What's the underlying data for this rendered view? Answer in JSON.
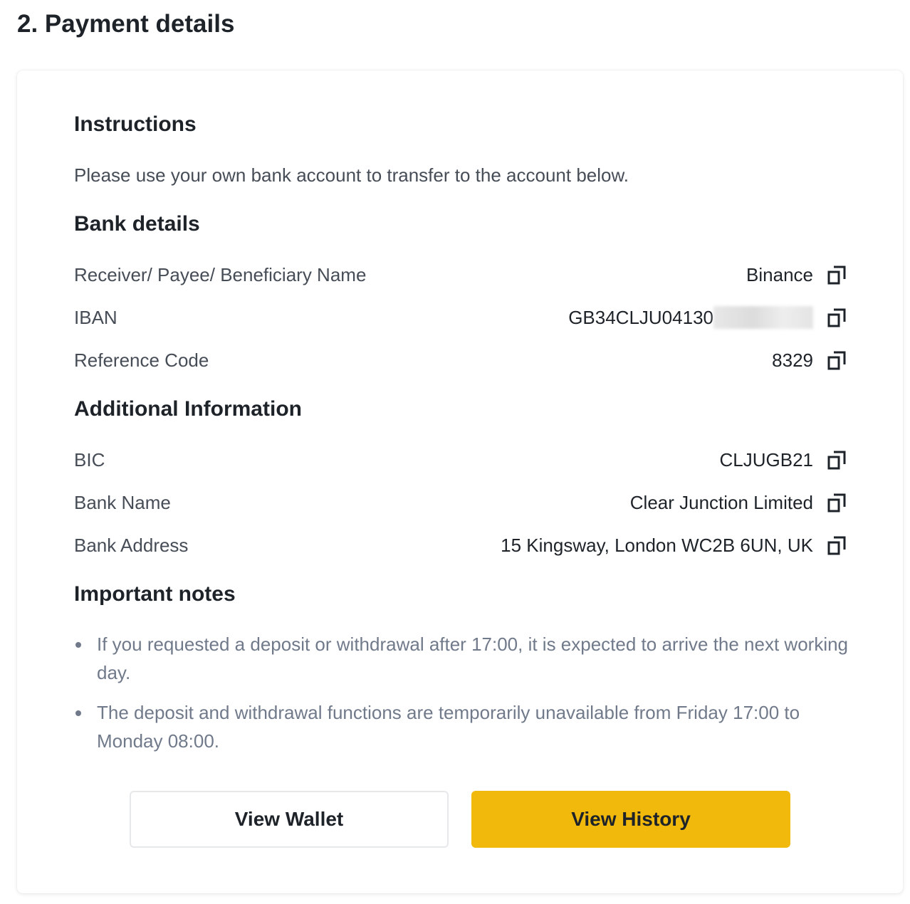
{
  "page": {
    "title": "2. Payment details"
  },
  "instructions": {
    "heading": "Instructions",
    "text": "Please use your own bank account to transfer to the account below."
  },
  "bank_details": {
    "heading": "Bank details",
    "rows": [
      {
        "label": "Receiver/ Payee/ Beneficiary Name",
        "value": "Binance"
      },
      {
        "label": "IBAN",
        "value": "GB34CLJU04130"
      },
      {
        "label": "Reference Code",
        "value": "8329"
      }
    ]
  },
  "additional_info": {
    "heading": "Additional Information",
    "rows": [
      {
        "label": "BIC",
        "value": "CLJUGB21"
      },
      {
        "label": "Bank Name",
        "value": "Clear Junction Limited"
      },
      {
        "label": "Bank Address",
        "value": "15 Kingsway, London WC2B 6UN, UK"
      }
    ]
  },
  "important_notes": {
    "heading": "Important notes",
    "items": [
      "If you requested a deposit or withdrawal after 17:00, it is expected to arrive the next working day.",
      "The deposit and withdrawal functions are temporarily unavailable from Friday 17:00 to Monday 08:00."
    ]
  },
  "buttons": {
    "view_wallet": "View Wallet",
    "view_history": "View History"
  },
  "colors": {
    "accent": "#f0b90b",
    "text_primary": "#1e2329",
    "text_secondary": "#474d57",
    "text_muted": "#707a8a"
  },
  "icons": {
    "copy": "copy-icon"
  }
}
